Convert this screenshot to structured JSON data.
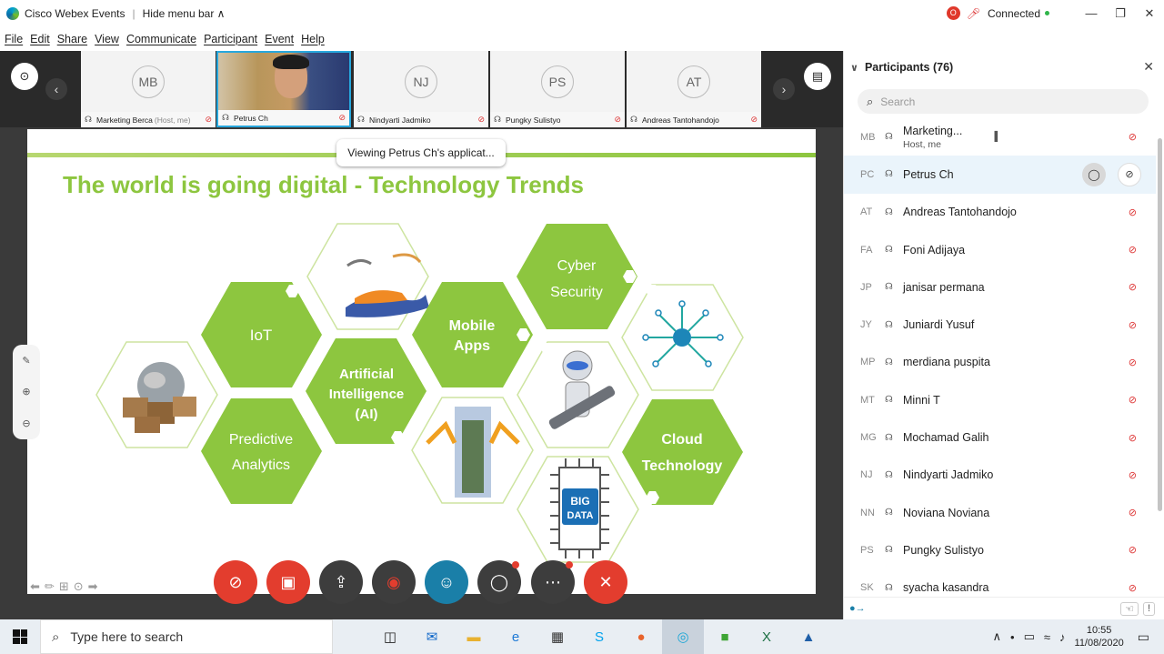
{
  "app": {
    "title": "Cisco Webex Events",
    "hide_menu": "Hide menu bar ∧",
    "status": "Connected",
    "rec_icon": "O"
  },
  "menu": [
    "File",
    "Edit",
    "Share",
    "View",
    "Communicate",
    "Participant",
    "Event",
    "Help"
  ],
  "thumbnails": [
    {
      "initials": "MB",
      "name": "Marketing Berca",
      "note": "(Host, me)"
    },
    {
      "initials": "",
      "name": "Petrus Ch",
      "note": ""
    },
    {
      "initials": "NJ",
      "name": "Nindyarti Jadmiko",
      "note": ""
    },
    {
      "initials": "PS",
      "name": "Pungky Sulistyo",
      "note": ""
    },
    {
      "initials": "AT",
      "name": "Andreas Tantohandojo",
      "note": ""
    }
  ],
  "viewing": "Viewing Petrus Ch's applicat...",
  "slide": {
    "title": "The world is going digital - Technology Trends",
    "hexes": {
      "iot": [
        "IoT"
      ],
      "predictive": [
        "Predictive",
        "Analytics"
      ],
      "ai": [
        "Artificial",
        "Intelligence",
        "(AI)"
      ],
      "mobile": [
        "Mobile",
        "Apps"
      ],
      "cyber": [
        "Cyber",
        "Security"
      ],
      "cloud": [
        "Cloud",
        "Technology"
      ],
      "bigdata": [
        "BIG",
        "DATA"
      ]
    }
  },
  "panel": {
    "header": "Participants (76)",
    "search_placeholder": "Search",
    "participants": [
      {
        "initials": "MB",
        "name": "Marketing...",
        "sub": "Host, me"
      },
      {
        "initials": "PC",
        "name": "Petrus Ch",
        "sub": ""
      },
      {
        "initials": "AT",
        "name": "Andreas Tantohandojo",
        "sub": ""
      },
      {
        "initials": "FA",
        "name": "Foni Adijaya",
        "sub": ""
      },
      {
        "initials": "JP",
        "name": "janisar permana",
        "sub": ""
      },
      {
        "initials": "JY",
        "name": "Juniardi Yusuf",
        "sub": ""
      },
      {
        "initials": "MP",
        "name": "merdiana puspita",
        "sub": ""
      },
      {
        "initials": "MT",
        "name": "Minni T",
        "sub": ""
      },
      {
        "initials": "MG",
        "name": "Mochamad Galih",
        "sub": ""
      },
      {
        "initials": "NJ",
        "name": "Nindyarti Jadmiko",
        "sub": ""
      },
      {
        "initials": "NN",
        "name": "Noviana Noviana",
        "sub": ""
      },
      {
        "initials": "PS",
        "name": "Pungky Sulistyo",
        "sub": ""
      },
      {
        "initials": "SK",
        "name": "syacha kasandra",
        "sub": ""
      }
    ]
  },
  "taskbar": {
    "search": "Type here to search",
    "time": "10:55",
    "date": "11/08/2020"
  },
  "colors": {
    "accent": "#8dc63f",
    "control_red": "#e33d2e",
    "active_border": "#27a7dd"
  }
}
